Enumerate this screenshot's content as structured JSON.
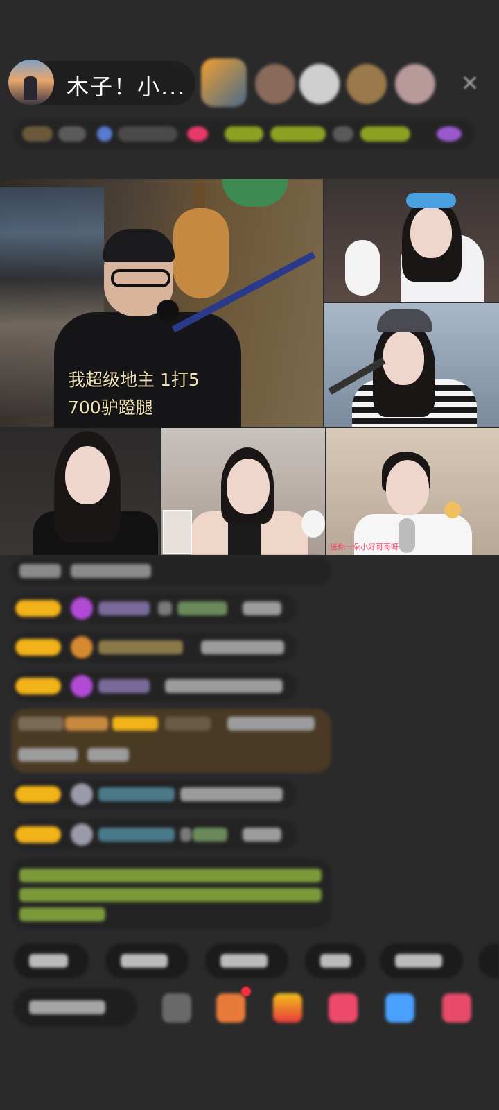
{
  "header": {
    "host_name": "木子！小...",
    "close_label": "✕"
  },
  "stream": {
    "main_overlay_text": "我超级地主 1打5\n700驴蹬腿",
    "tile_label": "送你一朵小好哥哥呀"
  },
  "colors": {
    "background": "#2a2a2b",
    "level_badge": "#f2b318",
    "overlay_text": "#f3e3b4",
    "guard_banner": "#4a3a24",
    "system_text": "#9fcf3a"
  },
  "icons": {
    "close": "close-icon",
    "gift": "gift-icon",
    "emoji": "emoji-icon",
    "more": "more-icon"
  }
}
